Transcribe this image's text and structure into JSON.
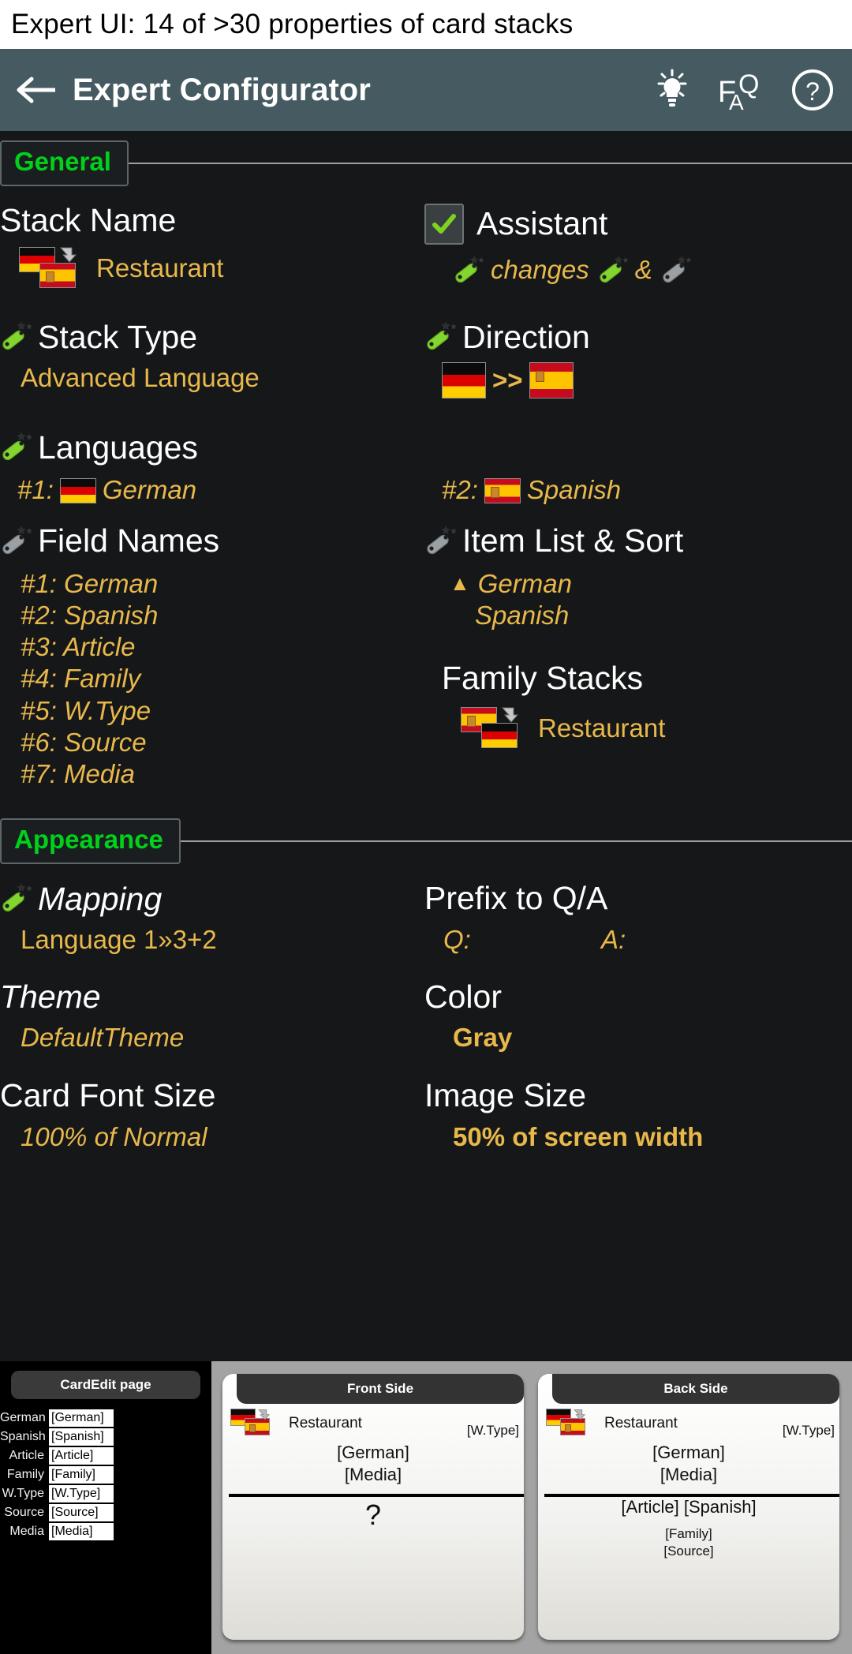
{
  "caption": "Expert UI: 14 of >30 properties of card stacks",
  "appbar": {
    "title": "Expert Configurator",
    "back_icon": "back-arrow-icon",
    "icons": [
      {
        "name": "lightbulb-icon",
        "label": "Tips"
      },
      {
        "name": "faq-icon",
        "f": "F",
        "a": "A",
        "q": "Q"
      },
      {
        "name": "help-circle-icon",
        "label": "?"
      }
    ]
  },
  "sections": [
    {
      "legend": "General",
      "items": {
        "stack_name": {
          "label": "Stack Name",
          "value": "Restaurant",
          "icon": "flag-pair-de-es-icon"
        },
        "assistant": {
          "label": "Assistant",
          "checked": true,
          "note": "changes",
          "amp": "&"
        },
        "stack_type": {
          "label": "Stack Type",
          "value": "Advanced Language",
          "wand": "green"
        },
        "direction": {
          "label": "Direction",
          "value": ">>",
          "from": "German",
          "to": "Spanish",
          "wand": "green"
        },
        "languages": {
          "label": "Languages",
          "wand": "green",
          "entries": [
            {
              "index": "#1:",
              "name": "German",
              "flag": "de"
            },
            {
              "index": "#2:",
              "name": "Spanish",
              "flag": "es"
            }
          ]
        },
        "field_names": {
          "label": "Field Names",
          "wand": "gray",
          "entries": [
            "#1: German",
            "#2: Spanish",
            "#3: Article",
            "#4: Family",
            "#5: W.Type",
            "#6: Source",
            "#7: Media"
          ]
        },
        "item_list_sort": {
          "label": "Item List & Sort",
          "wand": "gray",
          "caret": "▲",
          "entries": [
            "German",
            "Spanish"
          ]
        },
        "family_stacks": {
          "label": "Family Stacks",
          "value": "Restaurant",
          "icon": "flag-pair-es-de-icon"
        }
      }
    },
    {
      "legend": "Appearance",
      "items": {
        "mapping": {
          "label": "Mapping",
          "value": "Language 1»3+2",
          "wand": "green"
        },
        "prefix": {
          "label": "Prefix to Q/A",
          "q": "Q:",
          "a": "A:"
        },
        "theme": {
          "label": "Theme",
          "value": "DefaultTheme"
        },
        "color": {
          "label": "Color",
          "value": "Gray"
        },
        "card_font_size": {
          "label": "Card Font Size",
          "value": "100% of Normal"
        },
        "image_size": {
          "label": "Image Size",
          "value": "50% of screen width"
        }
      }
    }
  ],
  "preview": {
    "cardedit": {
      "title": "CardEdit page",
      "rows": [
        {
          "name": "German",
          "value": "[German]"
        },
        {
          "name": "Spanish",
          "value": "[Spanish]"
        },
        {
          "name": "Article",
          "value": "[Article]"
        },
        {
          "name": "Family",
          "value": "[Family]"
        },
        {
          "name": "W.Type",
          "value": "[W.Type]"
        },
        {
          "name": "Source",
          "value": "[Source]"
        },
        {
          "name": "Media",
          "value": "[Media]"
        }
      ]
    },
    "front_card": {
      "tab": "Front Side",
      "stack_name": "Restaurant",
      "wtype": "[W.Type]",
      "line1": "[German]",
      "line2": "[Media]",
      "answer": "?"
    },
    "back_card": {
      "tab": "Back Side",
      "stack_name": "Restaurant",
      "wtype": "[W.Type]",
      "line1": "[German]",
      "line2": "[Media]",
      "answer1": "[Article] [Spanish]",
      "answer2a": "[Family]",
      "answer2b": "[Source]"
    }
  },
  "colors": {
    "appbar": "#455a61",
    "legend_green": "#00d21a",
    "value_gold": "#e8b84b",
    "background": "#151719",
    "wand_green": "#82d62f",
    "wand_gray": "#9aa0a3"
  }
}
